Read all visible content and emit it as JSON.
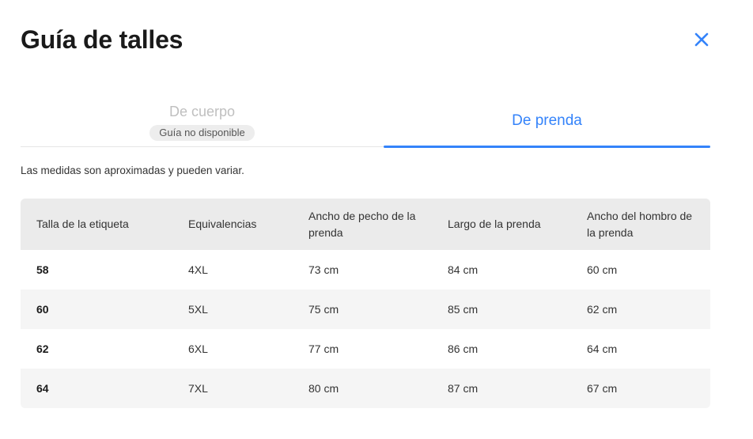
{
  "modal": {
    "title": "Guía de talles"
  },
  "icons": {
    "close": "close-icon"
  },
  "colors": {
    "accent": "#3483fa",
    "header_bg": "#ebebeb",
    "row_alt_bg": "#f5f5f5"
  },
  "tabs": [
    {
      "label": "De cuerpo",
      "badge": "Guía no disponible",
      "active": false
    },
    {
      "label": "De prenda",
      "active": true
    }
  ],
  "disclaimer": "Las medidas son aproximadas y pueden variar.",
  "table": {
    "headers": [
      "Talla de la etiqueta",
      "Equivalencias",
      "Ancho de pecho de la prenda",
      "Largo de la prenda",
      "Ancho del hombro de la prenda"
    ],
    "rows": [
      [
        "58",
        "4XL",
        "73 cm",
        "84 cm",
        "60 cm"
      ],
      [
        "60",
        "5XL",
        "75 cm",
        "85 cm",
        "62 cm"
      ],
      [
        "62",
        "6XL",
        "77 cm",
        "86 cm",
        "64 cm"
      ],
      [
        "64",
        "7XL",
        "80 cm",
        "87 cm",
        "67 cm"
      ]
    ]
  }
}
